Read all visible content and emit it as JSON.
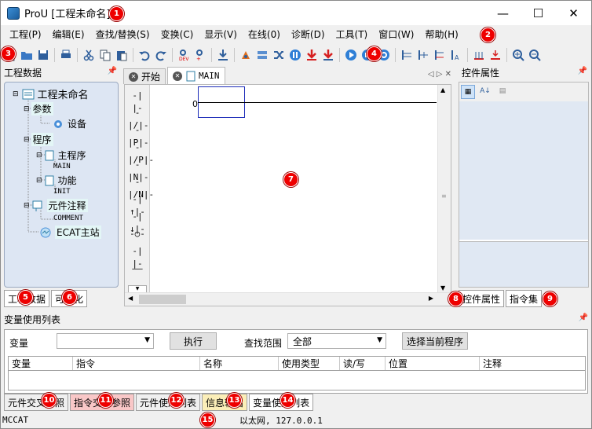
{
  "window": {
    "title": "ProU [工程未命名]",
    "min": "—",
    "max": "☐",
    "close": "✕"
  },
  "menu": [
    "工程(P)",
    "编辑(E)",
    "查找/替换(S)",
    "变换(C)",
    "显示(V)",
    "在线(0)",
    "诊断(D)",
    "工具(T)",
    "窗口(W)",
    "帮助(H)"
  ],
  "toolbar_icons": [
    "new-icon",
    "open-icon",
    "save-icon",
    "print-icon",
    "cut-icon",
    "copy-icon",
    "paste-icon",
    "undo-icon",
    "redo-icon",
    "dev-read-icon",
    "dev-write-icon",
    "download-icon",
    "compile-icon",
    "convert-icon",
    "cross-icon",
    "pause-icon",
    "arrow-down-icon",
    "arrow-down-bar-icon",
    "run-icon",
    "stop-icon",
    "reset-icon",
    "ladder-a-icon",
    "ladder-b-icon",
    "ladder-c-icon",
    "ladder-d-icon",
    "ladder-e-icon",
    "ladder-f-icon",
    "zoom-in-icon",
    "zoom-out-icon"
  ],
  "left_panel": {
    "title": "工程数据",
    "tree": {
      "root": "工程未命名",
      "params": "参数",
      "device": "设备",
      "program": "程序",
      "main_prog": "主程序",
      "main_tag": "MAIN",
      "func": "功能",
      "init_tag": "INIT",
      "comment": "元件注释",
      "comment_tag": "COMMENT",
      "ecat": "ECAT主站"
    },
    "tabs": [
      "工程数据",
      "可视化"
    ]
  },
  "doc_tabs": {
    "start": "开始",
    "main": "MAIN"
  },
  "editor": {
    "rung_number": "0",
    "palette": [
      "-| |-",
      "-|/|-",
      "-|P|-",
      "-|/P|-",
      "-|N|-",
      "-|/N|-",
      "-|↑|-",
      "-|↓|-",
      "-○-",
      "-| |-",
      "——"
    ]
  },
  "right_panel": {
    "title": "控件属性",
    "tabs": [
      "控件属性",
      "指令集"
    ]
  },
  "var_panel": {
    "title": "变量使用列表",
    "var_label": "变量",
    "var_value": "",
    "exec_button": "执行",
    "scope_label": "查找范围",
    "scope_value": "全部",
    "select_button": "选择当前程序",
    "columns": [
      "变量",
      "指令",
      "名称",
      "使用类型",
      "读/写",
      "位置",
      "注释"
    ]
  },
  "bottom_tabs": [
    "元件交叉参照",
    "指令交叉参照",
    "元件使用列表",
    "信息输出",
    "变量使用列表"
  ],
  "status": {
    "left": "MCCAT",
    "center": "以太网, 127.0.0.1"
  },
  "markers": [
    "1",
    "2",
    "3",
    "4",
    "5",
    "6",
    "7",
    "8",
    "9",
    "10",
    "11",
    "12",
    "13",
    "14",
    "15"
  ]
}
